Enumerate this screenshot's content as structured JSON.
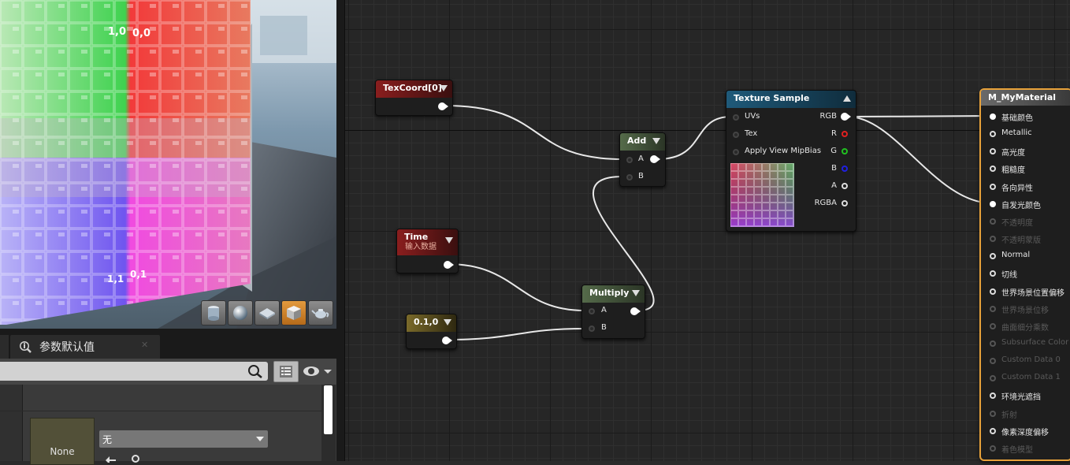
{
  "viewport": {
    "tile_labels": [
      "1,0",
      "0,0",
      "1,1",
      "0,1"
    ],
    "toolbar_buttons": [
      {
        "icon": "cylinder-icon",
        "active": false
      },
      {
        "icon": "sphere-icon",
        "active": false
      },
      {
        "icon": "plane-icon",
        "active": false
      },
      {
        "icon": "cube-icon",
        "active": true
      },
      {
        "icon": "teapot-icon",
        "active": false
      }
    ]
  },
  "param_panel": {
    "tab_label": "参数默认值",
    "thumbnail_label": "None",
    "dropdown_value": "无"
  },
  "nodes": {
    "texcoord": {
      "title": "TexCoord[0]"
    },
    "time": {
      "title": "Time",
      "subtitle": "输入数据"
    },
    "constant": {
      "title": "0.1,0"
    },
    "add": {
      "title": "Add",
      "pin_a": "A",
      "pin_b": "B"
    },
    "multiply": {
      "title": "Multiply",
      "pin_a": "A",
      "pin_b": "B"
    },
    "texture_sample": {
      "title": "Texture Sample",
      "inputs": [
        "UVs",
        "Tex",
        "Apply View MipBias"
      ],
      "outputs": [
        "RGB",
        "R",
        "G",
        "B",
        "A",
        "RGBA"
      ],
      "output_colors": [
        "#ffffff",
        "#e02020",
        "#20c020",
        "#2020e0",
        "#dddddd",
        "#dddddd"
      ]
    },
    "material": {
      "title": "M_MyMaterial",
      "inputs": [
        {
          "label": "基础颜色",
          "state": "connected"
        },
        {
          "label": "Metallic",
          "state": "enabled"
        },
        {
          "label": "高光度",
          "state": "enabled"
        },
        {
          "label": "粗糙度",
          "state": "enabled"
        },
        {
          "label": "各向异性",
          "state": "enabled"
        },
        {
          "label": "自发光颜色",
          "state": "connected"
        },
        {
          "label": "不透明度",
          "state": "disabled"
        },
        {
          "label": "不透明蒙版",
          "state": "disabled"
        },
        {
          "label": "Normal",
          "state": "enabled"
        },
        {
          "label": "切线",
          "state": "enabled"
        },
        {
          "label": "世界场景位置偏移",
          "state": "enabled"
        },
        {
          "label": "世界场景位移",
          "state": "disabled"
        },
        {
          "label": "曲面细分乘数",
          "state": "disabled"
        },
        {
          "label": "Subsurface Color",
          "state": "disabled"
        },
        {
          "label": "Custom Data 0",
          "state": "disabled"
        },
        {
          "label": "Custom Data 1",
          "state": "disabled"
        },
        {
          "label": "环境光遮挡",
          "state": "enabled"
        },
        {
          "label": "折射",
          "state": "disabled"
        },
        {
          "label": "像素深度偏移",
          "state": "enabled"
        },
        {
          "label": "着色模型",
          "state": "disabled"
        }
      ]
    }
  },
  "colors": {
    "texcoord_header": "#8a1e1e",
    "time_header": "#8a1e1e",
    "constant_header": "#7a6a2a",
    "add_header": "#556b4a",
    "multiply_header": "#556b4a",
    "texture_header": "#1f5a7a",
    "material_header": "#5a5a5a",
    "material_border": "#e8a23a",
    "active_toolbar": "#d98a2e"
  }
}
